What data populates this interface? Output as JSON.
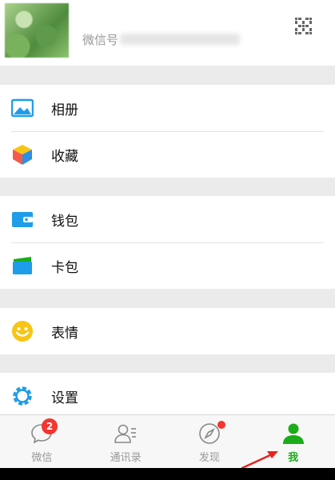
{
  "profile": {
    "name": "",
    "id_label": "微信号"
  },
  "menu": {
    "album": "相册",
    "favorites": "收藏",
    "wallet": "钱包",
    "cards": "卡包",
    "stickers": "表情",
    "settings": "设置"
  },
  "tabs": {
    "chats": {
      "label": "微信",
      "badge": "2"
    },
    "contacts": {
      "label": "通讯录"
    },
    "discover": {
      "label": "发现"
    },
    "me": {
      "label": "我"
    }
  },
  "colors": {
    "accent": "#1aad19",
    "badge": "#f43530",
    "blue": "#1e9de8",
    "yellow": "#f8c515"
  }
}
